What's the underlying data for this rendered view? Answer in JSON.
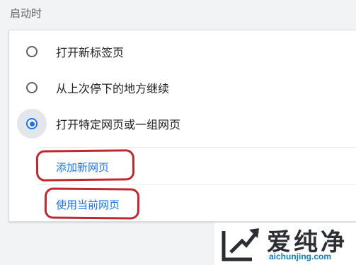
{
  "section": {
    "title": "启动时"
  },
  "startup_options": [
    {
      "label": "打开新标签页",
      "selected": false
    },
    {
      "label": "从上次停下的地方继续",
      "selected": false
    },
    {
      "label": "打开特定网页或一组网页",
      "selected": true
    }
  ],
  "actions": {
    "add_page": "添加新网页",
    "use_current": "使用当前网页"
  },
  "watermark": {
    "title": "爱纯净",
    "domain": "aichunjing.com"
  },
  "colors": {
    "accent": "#1a73e8",
    "highlight": "#c0282f",
    "background": "#f1f3f4"
  }
}
